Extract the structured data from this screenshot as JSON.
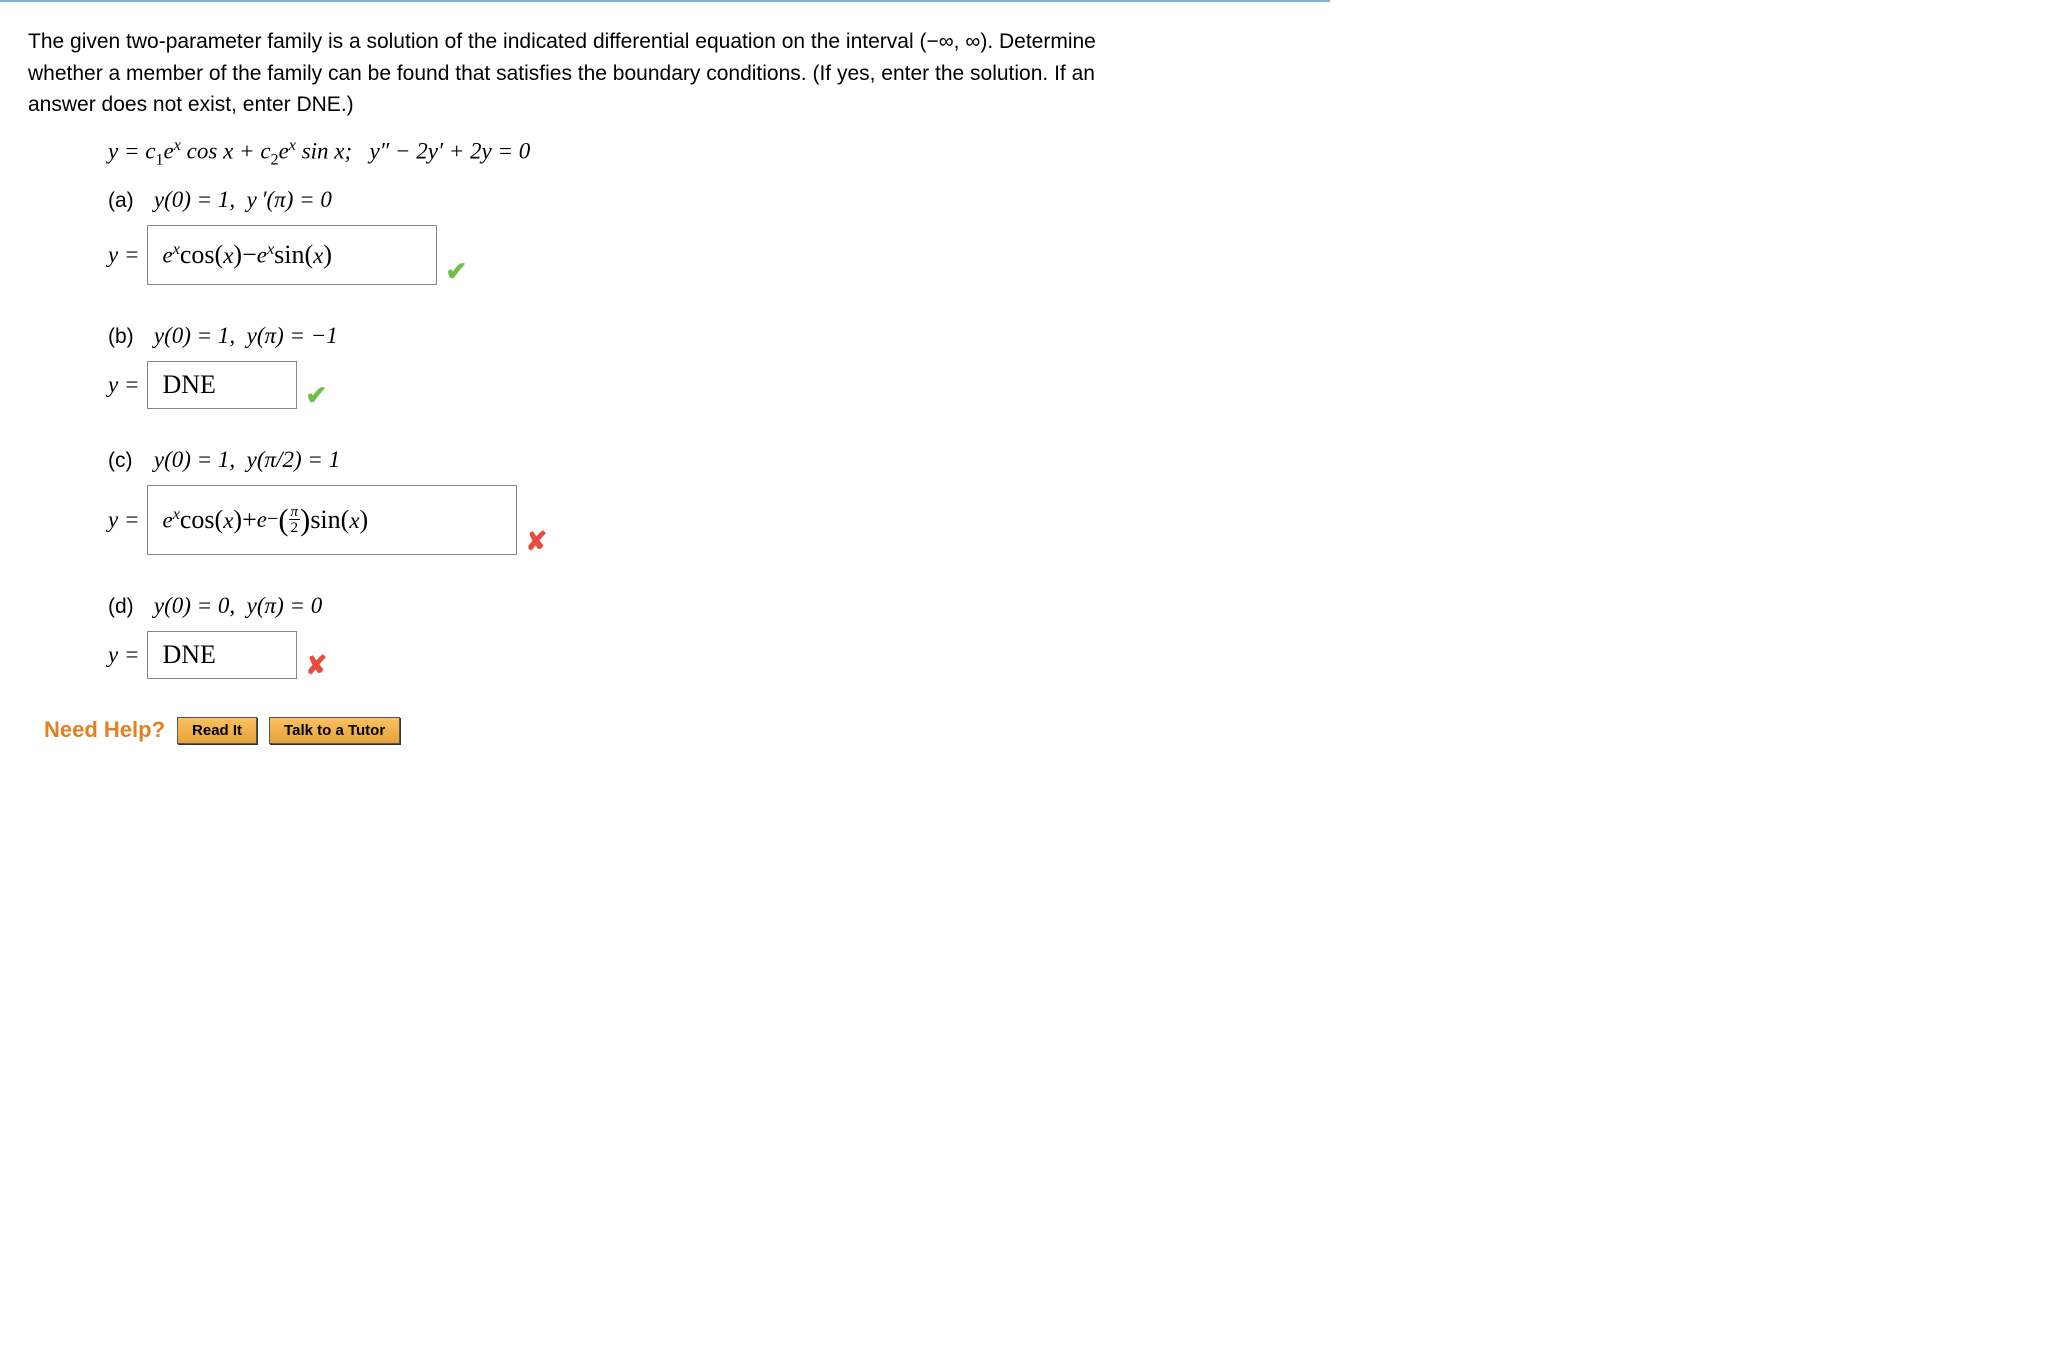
{
  "problem_text_1": "The given two-parameter family is a solution of the indicated differential equation on the interval  (−∞, ∞).  Determine",
  "problem_text_2": "whether a member of the family can be found that satisfies the boundary conditions. (If yes, enter the solution. If an",
  "problem_text_3": "answer does not exist, enter DNE.)",
  "equation": "y = c₁eˣ cos x + c₂eˣ sin x;   y″ − 2y′ + 2y = 0",
  "parts": {
    "a": {
      "label": "(a)",
      "conditions": "y(0) = 1,  y′(π) = 0",
      "y_equals": "y =",
      "answer": "eˣcos(x) − eˣsin(x)",
      "feedback": "correct"
    },
    "b": {
      "label": "(b)",
      "conditions": "y(0) = 1,  y(π) = −1",
      "y_equals": "y =",
      "answer": "DNE",
      "feedback": "correct"
    },
    "c": {
      "label": "(c)",
      "conditions": "y(0) = 1,  y(π/2) = 1",
      "y_equals": "y =",
      "answer": "eˣcos(x) + e^{−(π/2)}sin(x)",
      "feedback": "incorrect"
    },
    "d": {
      "label": "(d)",
      "conditions": "y(0) = 0,  y(π) = 0",
      "y_equals": "y =",
      "answer": "DNE",
      "feedback": "incorrect"
    }
  },
  "need_help": {
    "label": "Need Help?",
    "read_it": "Read It",
    "talk": "Talk to a Tutor"
  },
  "icons": {
    "correct": "✔",
    "incorrect": "✘"
  }
}
